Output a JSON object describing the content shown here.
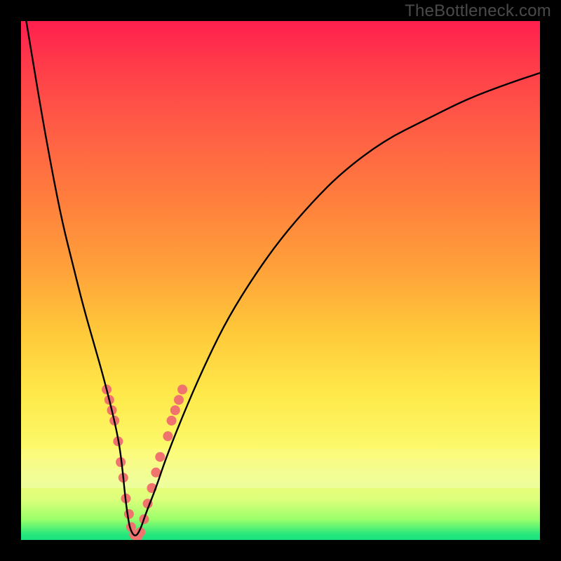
{
  "watermark": "TheBottleneck.com",
  "gradient": {
    "stops": [
      {
        "pos": 0,
        "color": "#ff1f4e"
      },
      {
        "pos": 8,
        "color": "#ff3a4a"
      },
      {
        "pos": 20,
        "color": "#ff5b46"
      },
      {
        "pos": 34,
        "color": "#ff7d3d"
      },
      {
        "pos": 48,
        "color": "#ffa23a"
      },
      {
        "pos": 60,
        "color": "#ffc93a"
      },
      {
        "pos": 72,
        "color": "#ffe94a"
      },
      {
        "pos": 84,
        "color": "#fbfc70"
      },
      {
        "pos": 92,
        "color": "#dfff7c"
      },
      {
        "pos": 96,
        "color": "#9bff6a"
      },
      {
        "pos": 99,
        "color": "#24e77d"
      },
      {
        "pos": 100,
        "color": "#1be27e"
      }
    ]
  },
  "chart_data": {
    "type": "line",
    "title": "",
    "xlabel": "",
    "ylabel": "",
    "xlim": [
      0,
      100
    ],
    "ylim": [
      0,
      100
    ],
    "grid": false,
    "series": [
      {
        "name": "bottleneck-curve",
        "color": "#000000",
        "x": [
          1,
          2,
          4,
          6,
          8,
          10,
          12,
          14,
          16,
          18,
          19,
          19.5,
          20,
          20.5,
          21,
          22,
          23,
          24,
          26,
          28,
          32,
          36,
          40,
          45,
          50,
          56,
          62,
          70,
          78,
          86,
          94,
          100
        ],
        "y": [
          100,
          94,
          82,
          71,
          61,
          53,
          45,
          38,
          31,
          23,
          18,
          14,
          9,
          5,
          2,
          0.5,
          2,
          5,
          10,
          16,
          26,
          35,
          43,
          51,
          58,
          65,
          71,
          77,
          81,
          85,
          88,
          90
        ]
      }
    ],
    "markers": {
      "name": "highlight-segments",
      "color": "#f0736e",
      "radius_px": 7,
      "points": [
        {
          "x": 16.5,
          "y": 29
        },
        {
          "x": 17.0,
          "y": 27
        },
        {
          "x": 17.5,
          "y": 25
        },
        {
          "x": 18.0,
          "y": 23
        },
        {
          "x": 18.7,
          "y": 19
        },
        {
          "x": 19.2,
          "y": 15
        },
        {
          "x": 19.7,
          "y": 12
        },
        {
          "x": 20.2,
          "y": 8
        },
        {
          "x": 20.8,
          "y": 5
        },
        {
          "x": 21.2,
          "y": 2.5
        },
        {
          "x": 21.8,
          "y": 1
        },
        {
          "x": 22.4,
          "y": 0.5
        },
        {
          "x": 23.0,
          "y": 1.5
        },
        {
          "x": 23.7,
          "y": 4
        },
        {
          "x": 24.4,
          "y": 7
        },
        {
          "x": 25.2,
          "y": 10
        },
        {
          "x": 26.0,
          "y": 13
        },
        {
          "x": 26.8,
          "y": 16
        },
        {
          "x": 28.3,
          "y": 20
        },
        {
          "x": 29.0,
          "y": 23
        },
        {
          "x": 29.7,
          "y": 25
        },
        {
          "x": 30.4,
          "y": 27
        },
        {
          "x": 31.1,
          "y": 29
        }
      ]
    }
  }
}
